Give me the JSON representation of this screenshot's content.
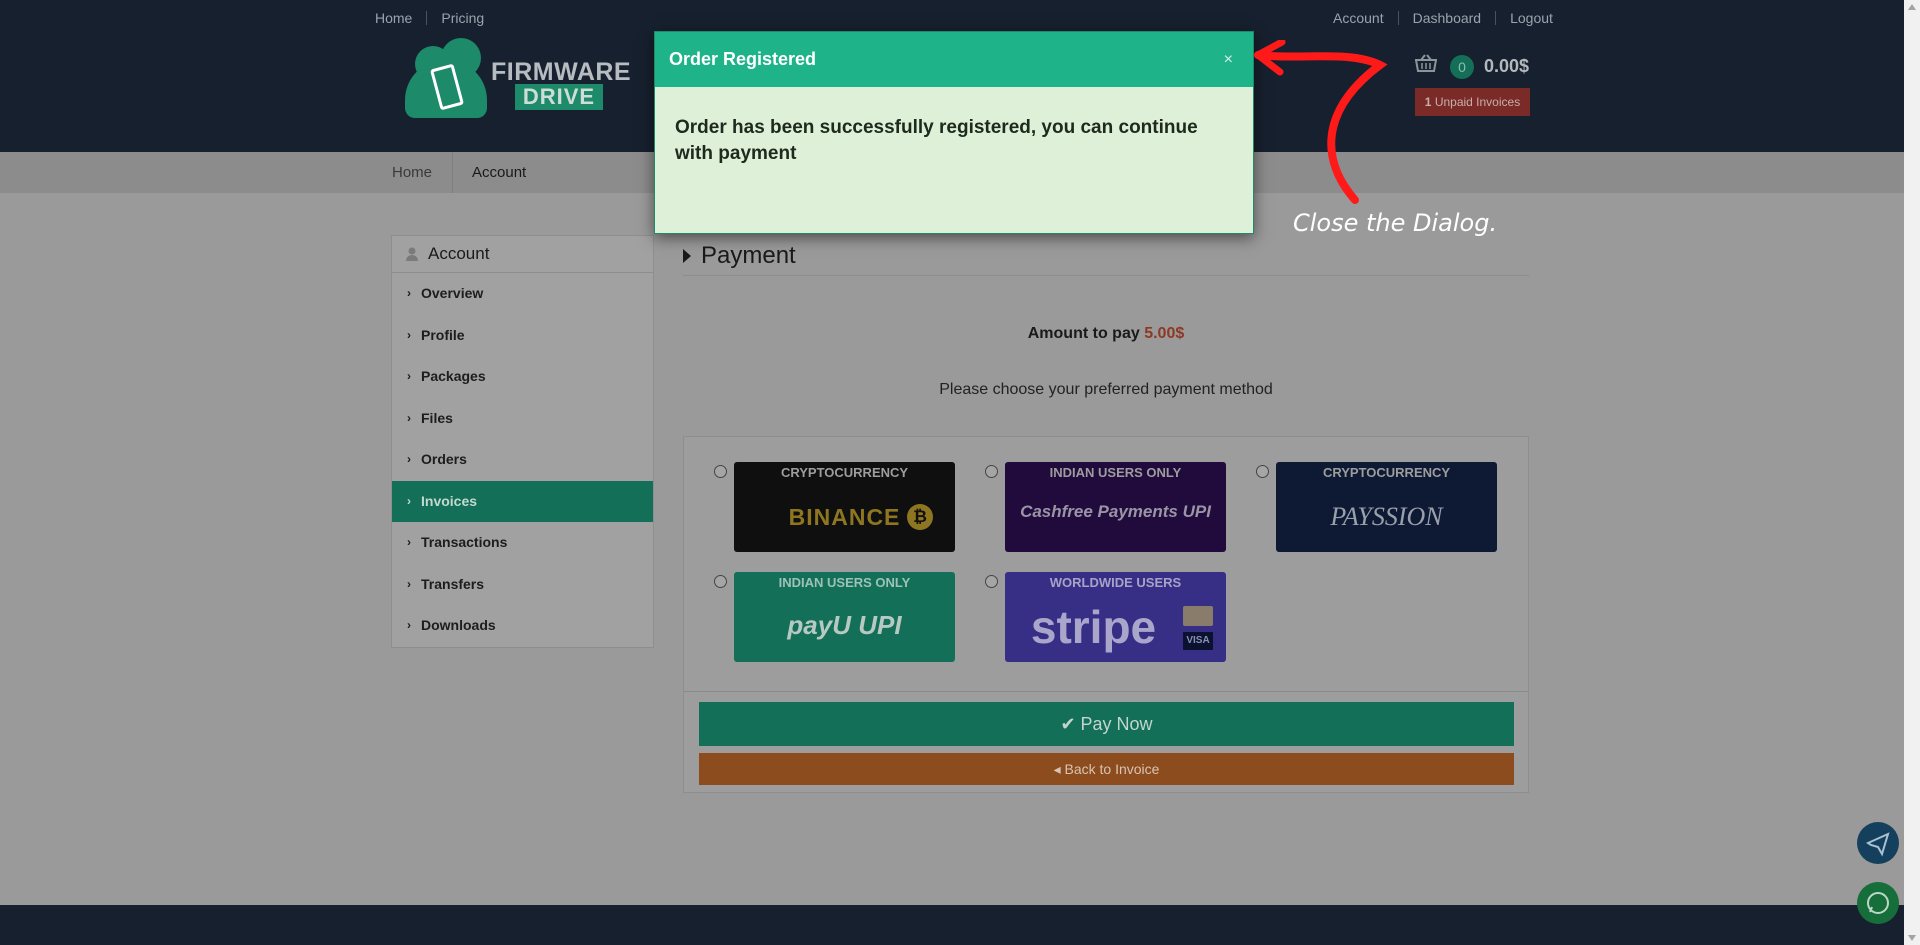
{
  "top_nav": {
    "left": [
      "Home",
      "Pricing"
    ],
    "right": [
      "Account",
      "Dashboard",
      "Logout"
    ]
  },
  "logo": {
    "line1": "FIRMWARE",
    "line2": "DRIVE"
  },
  "cart": {
    "count": "0",
    "total": "0.00$"
  },
  "unpaid": {
    "count": "1",
    "label": "Unpaid Invoices"
  },
  "subnav": [
    "Home",
    "Account"
  ],
  "sidebar": {
    "title": "Account",
    "items": [
      "Overview",
      "Profile",
      "Packages",
      "Files",
      "Orders",
      "Invoices",
      "Transactions",
      "Transfers",
      "Downloads"
    ],
    "active": "Invoices"
  },
  "payment": {
    "title": "Payment",
    "amount_label": "Amount to pay",
    "amount_value": "5.00$",
    "choose_text": "Please choose your preferred payment method",
    "methods": [
      {
        "tag": "CRYPTOCURRENCY",
        "brand": "BINANCE",
        "bg": "#0f0f0f"
      },
      {
        "tag": "INDIAN USERS ONLY",
        "brand": "Cashfree Payments UPI",
        "bg": "#200b3c"
      },
      {
        "tag": "CRYPTOCURRENCY",
        "brand": "PAYSSION",
        "bg": "#0e1a34"
      },
      {
        "tag": "INDIAN USERS ONLY",
        "brand": "payU UPI",
        "bg": "#136f57"
      },
      {
        "tag": "WORLDWIDE USERS",
        "brand": "stripe",
        "bg": "#372f86"
      }
    ],
    "pay_now": "Pay Now",
    "back": "Back to Invoice"
  },
  "modal": {
    "title": "Order Registered",
    "close": "×",
    "message": "Order has been successfully registered, you can continue with payment"
  },
  "annotation": "Close the Dialog.",
  "colors": {
    "accent": "#1fb38a",
    "danger": "#a83530",
    "arrow": "#ff1a1a"
  }
}
